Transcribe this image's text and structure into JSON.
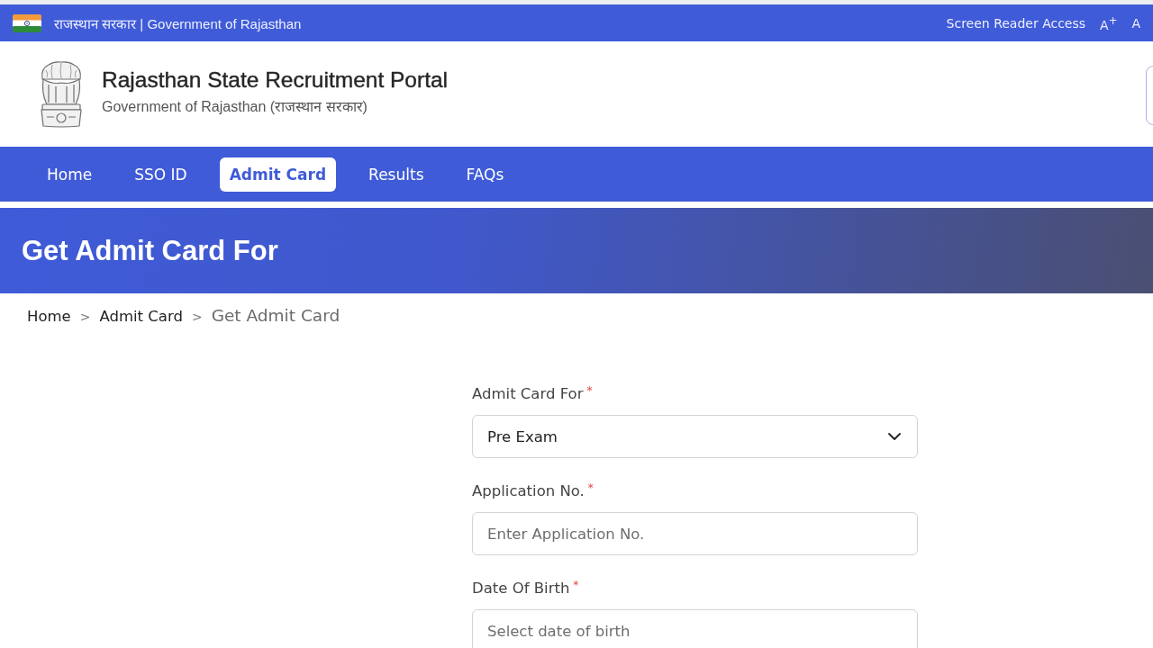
{
  "top_bar": {
    "government_label": "राजस्थान सरकार | Government of Rajasthan",
    "links": [
      "Screen Reader Access",
      "A$^{+}$",
      "A"
    ]
  },
  "header": {
    "title": "Rajasthan State Recruitment Portal",
    "subtitle": "Government of Rajasthan (राजस्थान सरकार)"
  },
  "nav": {
    "items": [
      {
        "label": "Home",
        "selected": false
      },
      {
        "label": "SSO ID",
        "selected": false
      },
      {
        "label": "Admit Card",
        "selected": true
      },
      {
        "label": "Results",
        "selected": false
      },
      {
        "label": "FAQs",
        "selected": false
      }
    ]
  },
  "banner": {
    "title": "Get Admit Card For"
  },
  "breadcrumb": {
    "items": [
      {
        "label": "Home",
        "current": false
      },
      {
        "label": "Admit Card",
        "current": false
      },
      {
        "label": "Get Admit Card",
        "current": true
      }
    ],
    "separators": [
      ">",
      ">"
    ]
  },
  "form": {
    "fields": [
      {
        "kind": "select",
        "label": "Admit Card For",
        "required_mark": "*",
        "value": "Pre Exam"
      },
      {
        "kind": "text",
        "label": "Application No.",
        "required_mark": "*",
        "placeholder": "Enter Application No."
      },
      {
        "kind": "date",
        "label": "Date Of Birth",
        "required_mark": "*",
        "placeholder": "Select date of birth"
      }
    ]
  }
}
